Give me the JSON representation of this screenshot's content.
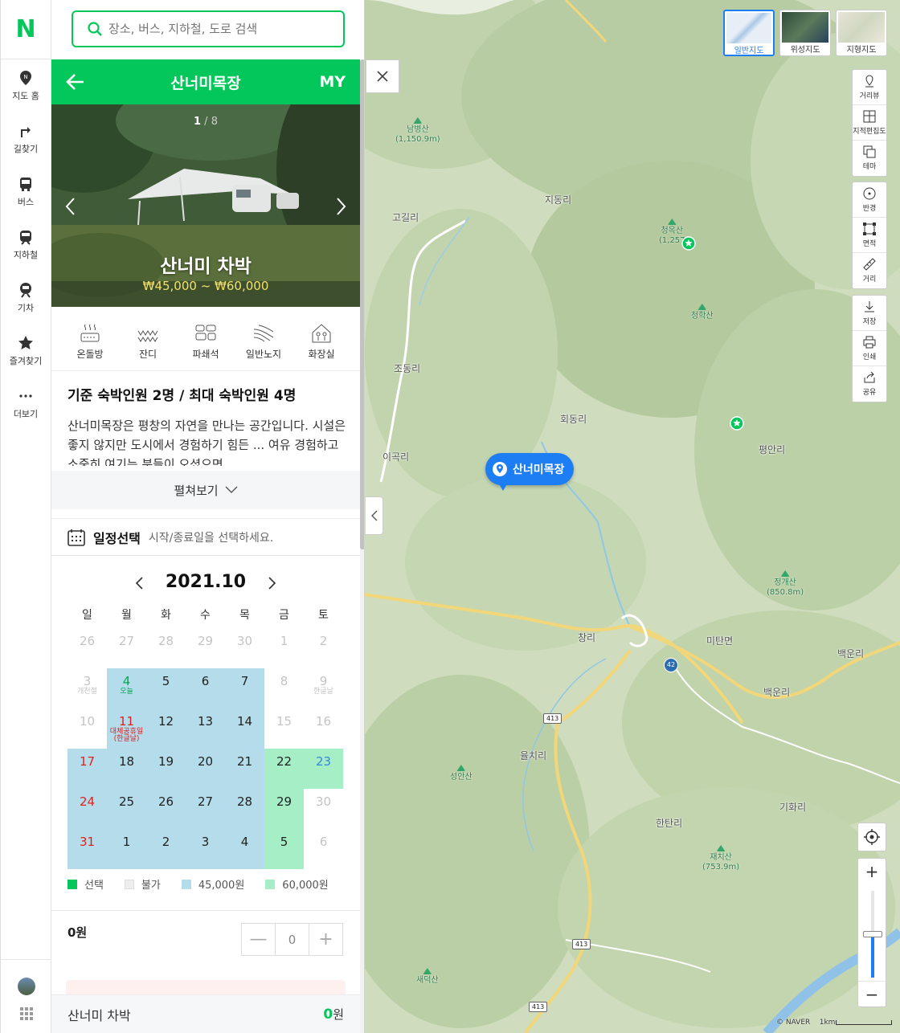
{
  "logo": "N",
  "nav": [
    {
      "label": "지도 홈",
      "icon": "map-home-icon"
    },
    {
      "label": "길찾기",
      "icon": "directions-icon"
    },
    {
      "label": "버스",
      "icon": "bus-icon"
    },
    {
      "label": "지하철",
      "icon": "subway-icon"
    },
    {
      "label": "기차",
      "icon": "train-icon"
    },
    {
      "label": "즐겨찾기",
      "icon": "star-icon"
    },
    {
      "label": "더보기",
      "icon": "more-icon"
    }
  ],
  "search": {
    "placeholder": "장소, 버스, 지하철, 도로 검색"
  },
  "header": {
    "title": "산너미목장",
    "my": "MY"
  },
  "photo": {
    "current": "1",
    "separator": " / ",
    "total": "8",
    "name": "산너미 차박",
    "price": "₩45,000 ~ ₩60,000"
  },
  "amenities": [
    {
      "label": "온돌방",
      "icon": "ondol-icon"
    },
    {
      "label": "잔디",
      "icon": "grass-icon"
    },
    {
      "label": "파쇄석",
      "icon": "gravel-icon"
    },
    {
      "label": "일반노지",
      "icon": "field-icon"
    },
    {
      "label": "화장실",
      "icon": "toilet-icon"
    }
  ],
  "capacity": "기준 숙박인원 2명 / 최대 숙박인원 4명",
  "description": "산너미목장은 평창의 자연을 만나는 공간입니다. 시설은 좋지 않지만 도시에서 경험하기 힘든 ... 여유 경험하고 소중히 여기는 분들이 오셨으면",
  "expand_label": "펼쳐보기",
  "schedule": {
    "title": "일정선택",
    "subtitle": "시작/종료일을 선택하세요."
  },
  "calendar": {
    "month": "2021.10",
    "weekdays": [
      "일",
      "월",
      "화",
      "수",
      "목",
      "금",
      "토"
    ],
    "weeks": [
      [
        {
          "d": "26",
          "c": "dim"
        },
        {
          "d": "27",
          "c": "dim"
        },
        {
          "d": "28",
          "c": "dim"
        },
        {
          "d": "29",
          "c": "dim"
        },
        {
          "d": "30",
          "c": "dim"
        },
        {
          "d": "1",
          "c": "dim"
        },
        {
          "d": "2",
          "c": "dim"
        }
      ],
      [
        {
          "d": "3",
          "c": "dim",
          "l": "개천절"
        },
        {
          "d": "4",
          "c": "grn",
          "bg": "bl",
          "l": "오늘"
        },
        {
          "d": "5",
          "bg": "bl"
        },
        {
          "d": "6",
          "bg": "bl"
        },
        {
          "d": "7",
          "bg": "bl"
        },
        {
          "d": "8",
          "c": "dim"
        },
        {
          "d": "9",
          "c": "dim",
          "l": "한글날"
        }
      ],
      [
        {
          "d": "10",
          "c": "dim"
        },
        {
          "d": "11",
          "c": "red",
          "bg": "bl",
          "l": "대체공휴일(한글날)"
        },
        {
          "d": "12",
          "bg": "bl"
        },
        {
          "d": "13",
          "bg": "bl"
        },
        {
          "d": "14",
          "bg": "bl"
        },
        {
          "d": "15",
          "c": "dim"
        },
        {
          "d": "16",
          "c": "dim"
        }
      ],
      [
        {
          "d": "17",
          "c": "red",
          "bg": "bl"
        },
        {
          "d": "18",
          "bg": "bl"
        },
        {
          "d": "19",
          "bg": "bl"
        },
        {
          "d": "20",
          "bg": "bl"
        },
        {
          "d": "21",
          "bg": "bl"
        },
        {
          "d": "22",
          "bg": "gr"
        },
        {
          "d": "23",
          "c": "blu",
          "bg": "gr"
        }
      ],
      [
        {
          "d": "24",
          "c": "red",
          "bg": "bl"
        },
        {
          "d": "25",
          "bg": "bl"
        },
        {
          "d": "26",
          "bg": "bl"
        },
        {
          "d": "27",
          "bg": "bl"
        },
        {
          "d": "28",
          "bg": "bl"
        },
        {
          "d": "29",
          "bg": "gr"
        },
        {
          "d": "30",
          "c": "dim"
        }
      ],
      [
        {
          "d": "31",
          "c": "red",
          "bg": "bl"
        },
        {
          "d": "1",
          "bg": "bl"
        },
        {
          "d": "2",
          "bg": "bl"
        },
        {
          "d": "3",
          "bg": "bl"
        },
        {
          "d": "4",
          "bg": "bl"
        },
        {
          "d": "5",
          "bg": "gr"
        },
        {
          "d": "6",
          "c": "dim"
        }
      ]
    ],
    "legend": [
      {
        "label": "선택",
        "color": "#03c75a"
      },
      {
        "label": "불가",
        "color": "#eeeeee"
      },
      {
        "label": "45,000원",
        "color": "#b4dcea"
      },
      {
        "label": "60,000원",
        "color": "#a5eec6"
      }
    ]
  },
  "quantity": {
    "amount": "0원",
    "value": "0",
    "minus": "—",
    "plus": "+"
  },
  "footer": {
    "name": "산너미 차박",
    "price": "0",
    "unit": "원"
  },
  "map": {
    "pin_label": "산너미목장",
    "map_types": [
      {
        "label": "일반지도",
        "selected": true
      },
      {
        "label": "위성지도",
        "selected": false
      },
      {
        "label": "지형지도",
        "selected": false
      }
    ],
    "tools_top": [
      {
        "label": "거리뷰",
        "icon": "street-view-icon"
      },
      {
        "label": "지적편집도",
        "icon": "cadastral-icon"
      },
      {
        "label": "테마",
        "icon": "theme-icon"
      }
    ],
    "tools_mid": [
      {
        "label": "반경",
        "icon": "radius-icon"
      },
      {
        "label": "면적",
        "icon": "area-icon"
      },
      {
        "label": "거리",
        "icon": "ruler-icon"
      }
    ],
    "tools_bottom": [
      {
        "label": "저장",
        "icon": "download-icon"
      },
      {
        "label": "인쇄",
        "icon": "print-icon"
      },
      {
        "label": "공유",
        "icon": "share-icon"
      }
    ],
    "labels": [
      "지동리",
      "고길리",
      "조동리",
      "회동리",
      "평안리",
      "이곡리",
      "창리",
      "미탄면",
      "백운리",
      "백운리",
      "율치리",
      "기화리",
      "한탄리"
    ],
    "peaks": [
      {
        "name": "남병산",
        "elev": "(1,150.9m)"
      },
      {
        "name": "청옥산",
        "elev": "(1,257"
      },
      {
        "name": "청학산",
        "elev": ""
      },
      {
        "name": "정개산",
        "elev": "(850.8m)"
      },
      {
        "name": "성안산",
        "elev": ""
      },
      {
        "name": "재치산",
        "elev": "(753.9m)"
      },
      {
        "name": "새덕산",
        "elev": ""
      }
    ],
    "roads": [
      "42",
      "413",
      "413",
      "413"
    ],
    "zoom_level": 0.5,
    "credits": "© NAVER",
    "scale": "1km"
  }
}
